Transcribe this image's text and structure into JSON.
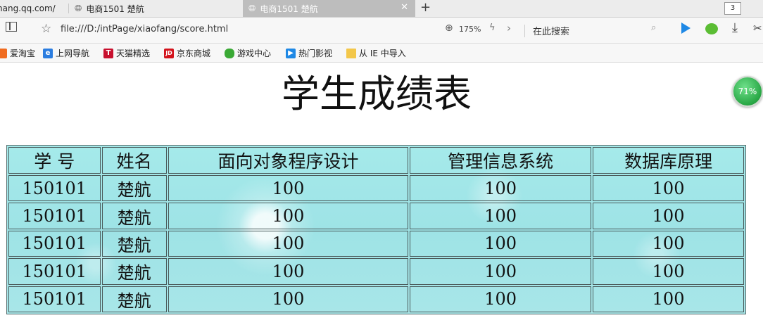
{
  "tabs": [
    {
      "label": "hang.qq.com/",
      "active": false
    },
    {
      "label": "电商1501 楚航",
      "active": false
    },
    {
      "label": "电商1501 楚航",
      "active": true
    }
  ],
  "tab_count": "3",
  "address_bar": {
    "url": "file:///D:/intPage/xiaofang/score.html",
    "zoom": "175%",
    "search_placeholder": "在此搜索"
  },
  "bookmarks": [
    {
      "label": "爱淘宝",
      "icon": "taobao-icon"
    },
    {
      "label": "上网导航",
      "icon": "ie-icon"
    },
    {
      "label": "天猫精选",
      "icon": "tmall-icon"
    },
    {
      "label": "京东商城",
      "icon": "jd-icon"
    },
    {
      "label": "游戏中心",
      "icon": "gamepad-icon"
    },
    {
      "label": "热门影视",
      "icon": "video-play-icon"
    },
    {
      "label": "从 IE 中导入",
      "icon": "folder-icon"
    }
  ],
  "speed_badge": "71%",
  "page": {
    "title": "学生成绩表",
    "table": {
      "headers": [
        "学  号",
        "姓名",
        "面向对象程序设计",
        "管理信息系统",
        "数据库原理"
      ],
      "rows": [
        [
          "150101",
          "楚航",
          "100",
          "100",
          "100"
        ],
        [
          "150101",
          "楚航",
          "100",
          "100",
          "100"
        ],
        [
          "150101",
          "楚航",
          "100",
          "100",
          "100"
        ],
        [
          "150101",
          "楚航",
          "100",
          "100",
          "100"
        ],
        [
          "150101",
          "楚航",
          "100",
          "100",
          "100"
        ]
      ]
    }
  },
  "colors": {
    "table_background": "#9ee3e6",
    "active_tab": "#bdbdbd",
    "cell_border": "#4a5a5a"
  }
}
